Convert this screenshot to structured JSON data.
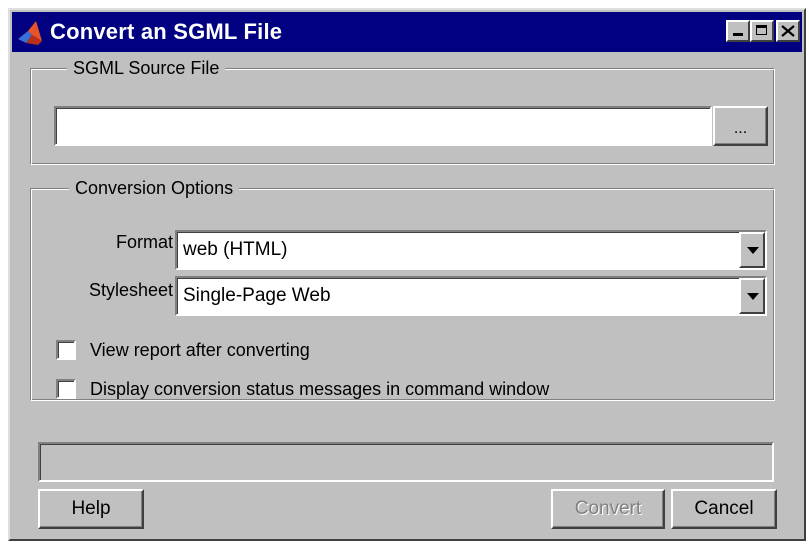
{
  "window": {
    "title": "Convert an SGML File",
    "app_icon": "matlab-logo-icon",
    "controls": [
      "minimize-icon",
      "maximize-icon",
      "close-icon"
    ]
  },
  "source_group": {
    "legend": "SGML Source File",
    "file_input": {
      "value": "",
      "placeholder": ""
    },
    "browse_label": "..."
  },
  "options_group": {
    "legend": "Conversion Options",
    "format": {
      "label": "Format",
      "selected": "web (HTML)"
    },
    "stylesheet": {
      "label": "Stylesheet",
      "selected": "Single-Page Web"
    },
    "checkboxes": [
      {
        "label": "View report after converting",
        "checked": false
      },
      {
        "label": "Display conversion status messages in command window",
        "checked": false
      }
    ]
  },
  "status": {
    "text": ""
  },
  "buttons": {
    "help": "Help",
    "convert": "Convert",
    "cancel": "Cancel"
  },
  "colors": {
    "titlebar": "#000080",
    "face": "#c0c0c0",
    "disabled_text": "#808080"
  }
}
